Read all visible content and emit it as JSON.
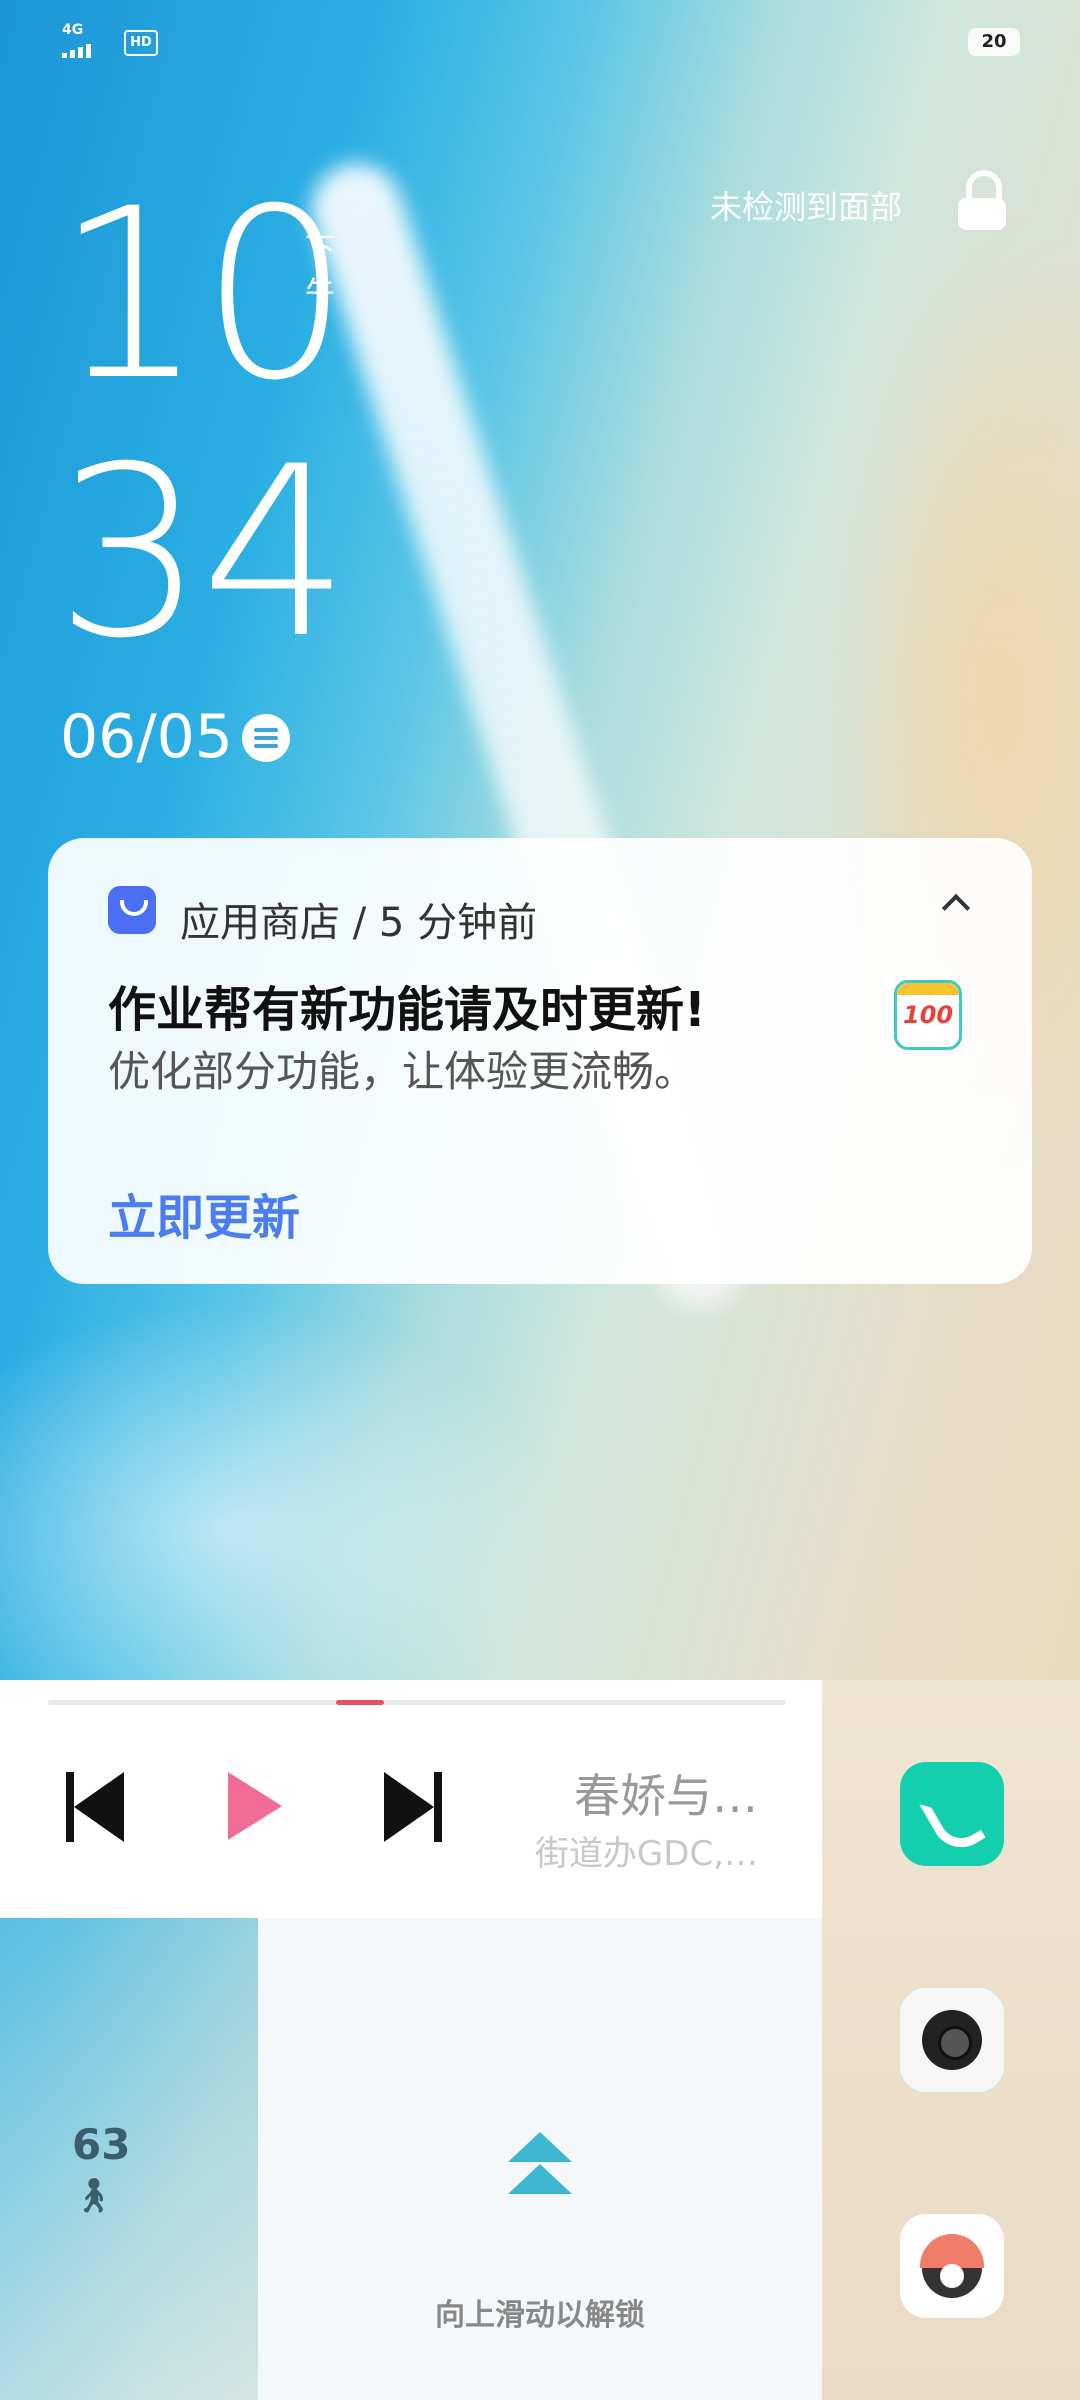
{
  "status_bar": {
    "network": "4G",
    "hd": "HD",
    "battery": "20"
  },
  "lock_screen": {
    "hour": "10",
    "minute": "34",
    "ampm": "下午",
    "date": "06/05",
    "face_status": "未检测到面部"
  },
  "notification": {
    "app_name": "应用商店",
    "separator": "/",
    "time_ago": "5 分钟前",
    "title": "作业帮有新功能请及时更新!",
    "body": "优化部分功能，让体验更流畅。",
    "action": "立即更新",
    "thumbnail_text": "100"
  },
  "media_player": {
    "song": "春娇与…",
    "artist": "街道办GDC,…",
    "progress": 0.39
  },
  "steps": {
    "count": "63"
  },
  "unlock": {
    "hint": "向上滑动以解锁"
  },
  "colors": {
    "notification_action": "#4a7df1",
    "play_button": "#f06c95",
    "progress_fill": "#e8505b",
    "phone_app": "#13cfae",
    "unlock_arrow": "#3fb6cf"
  }
}
